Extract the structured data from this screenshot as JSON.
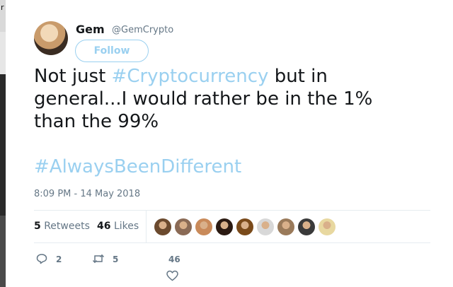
{
  "side_fragment": "r",
  "author": {
    "name": "Gem",
    "handle": "@GemCrypto",
    "avatar_icon": "profile-photo"
  },
  "follow_label": "Follow",
  "tweet": {
    "line1_pre": "Not just ",
    "line1_tag": "#Cryptocurrency",
    "line1_post": " but in",
    "line2": "general...I would rather be in the 1%",
    "line3": "than the 99%",
    "hashtag": "#AlwaysBeenDifferent"
  },
  "timestamp": "8:09 PM - 14 May 2018",
  "stats": {
    "retweets_count": "5",
    "retweets_label": "Retweets",
    "likes_count": "46",
    "likes_label": "Likes"
  },
  "liker_faces": [
    "#6b4a2e",
    "#8a6a55",
    "#c98a5a",
    "#2b1a12",
    "#7a4a1a",
    "#d8d8d8",
    "#9a7a5a",
    "#3a3a3a",
    "#e8d8a0"
  ],
  "actions": {
    "reply_count": "2",
    "retweet_count": "5",
    "like_count": "46"
  },
  "colors": {
    "link": "#9ad0f0",
    "muted": "#657786",
    "text": "#14171a"
  }
}
